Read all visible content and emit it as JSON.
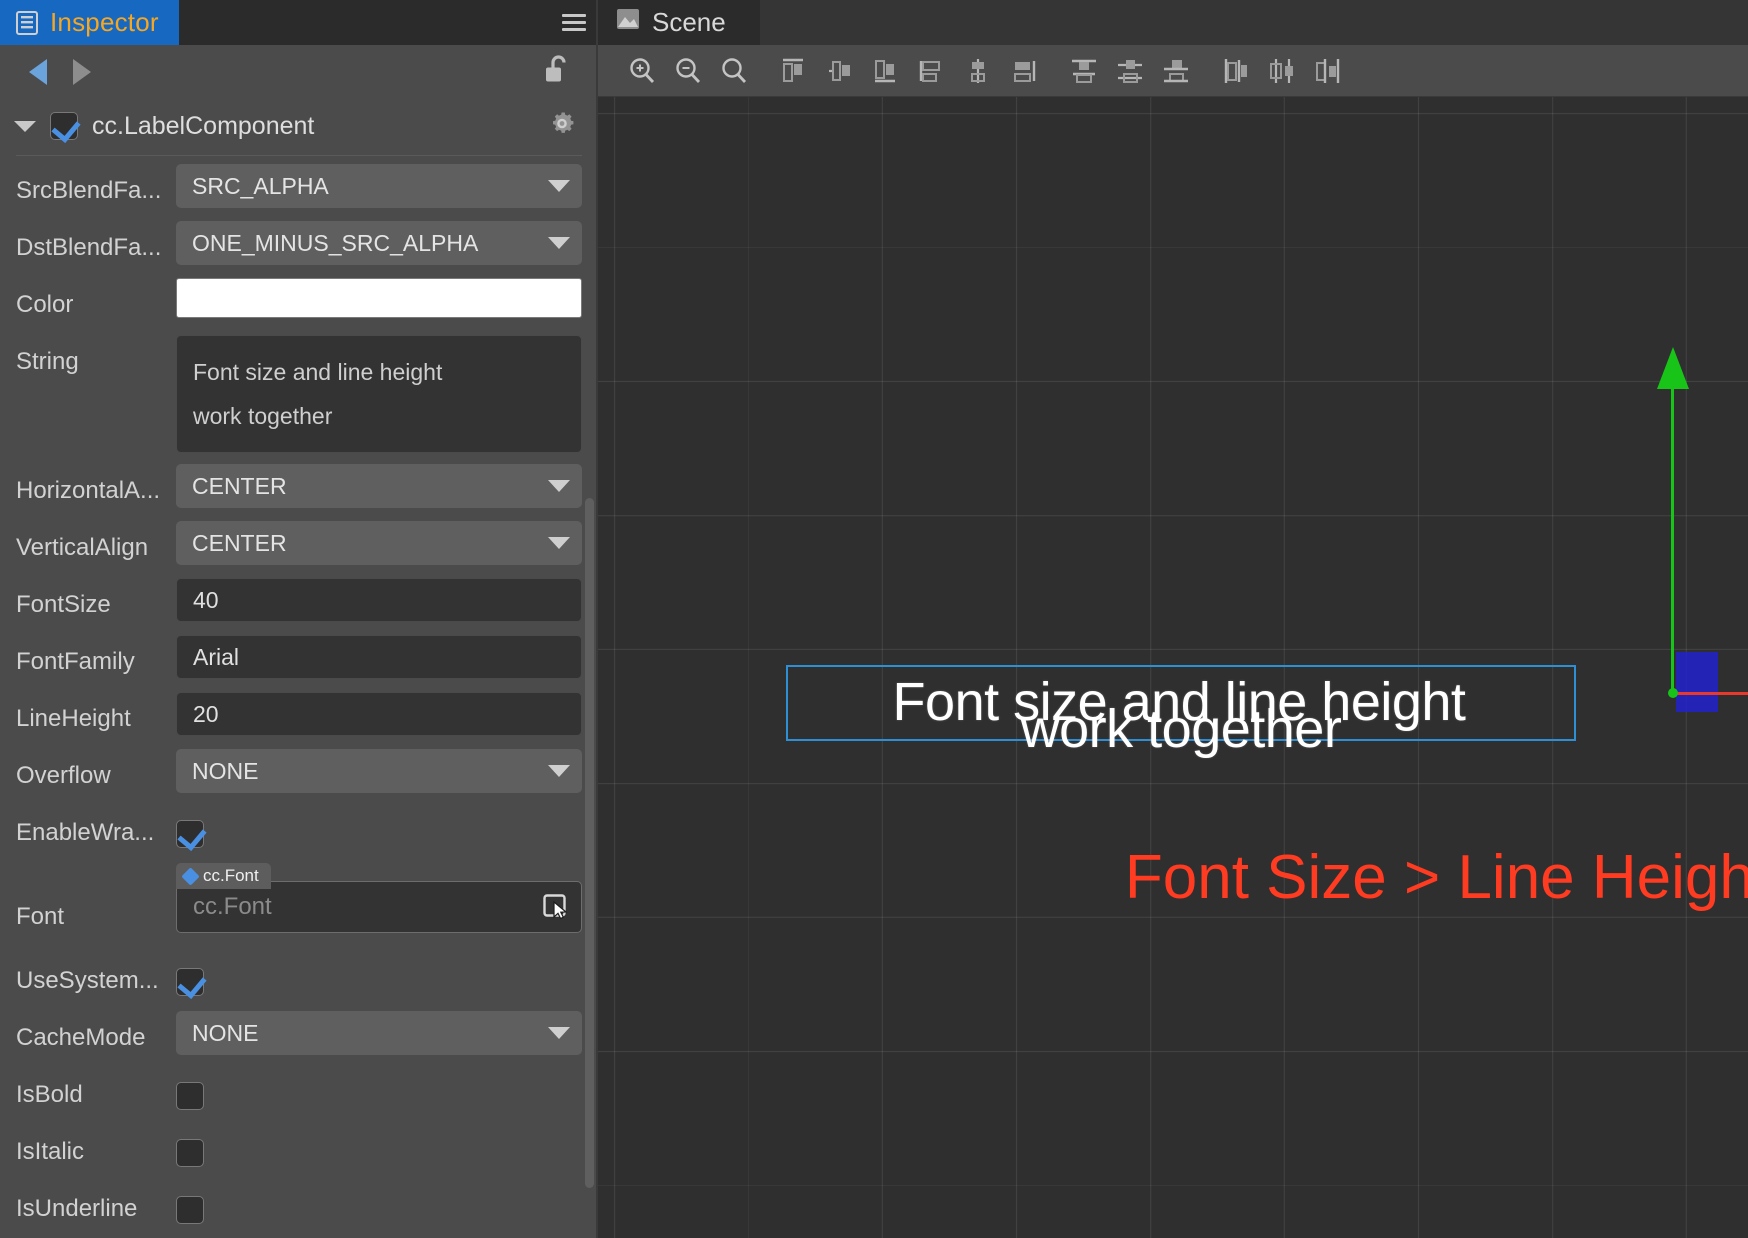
{
  "inspector": {
    "tab_label": "Inspector",
    "tab_icon": "inspector-icon",
    "menu_icon": "hamburger-menu-icon",
    "nav": {
      "back_icon": "arrow-left-icon",
      "forward_icon": "arrow-right-icon",
      "lock_icon": "unlocked-padlock-icon"
    },
    "component": {
      "title": "cc.LabelComponent",
      "enabled": true,
      "collapse_icon": "caret-down-icon",
      "settings_icon": "gear-icon"
    },
    "properties": [
      {
        "label": "SrcBlendFa...",
        "type": "select",
        "value": "SRC_ALPHA",
        "name": "src-blend-factor"
      },
      {
        "label": "DstBlendFa...",
        "type": "select",
        "value": "ONE_MINUS_SRC_ALPHA",
        "name": "dst-blend-factor"
      },
      {
        "label": "Color",
        "type": "color",
        "value": "#FFFFFF",
        "name": "color"
      },
      {
        "label": "String",
        "type": "textarea",
        "lines": [
          "Font size and line height",
          "work together"
        ],
        "name": "string"
      },
      {
        "label": "HorizontalA...",
        "type": "select",
        "value": "CENTER",
        "name": "horizontal-align"
      },
      {
        "label": "VerticalAlign",
        "type": "select",
        "value": "CENTER",
        "name": "vertical-align"
      },
      {
        "label": "FontSize",
        "type": "input",
        "value": "40",
        "name": "font-size"
      },
      {
        "label": "FontFamily",
        "type": "input",
        "value": "Arial",
        "name": "font-family"
      },
      {
        "label": "LineHeight",
        "type": "input",
        "value": "20",
        "name": "line-height"
      },
      {
        "label": "Overflow",
        "type": "select",
        "value": "NONE",
        "name": "overflow"
      },
      {
        "label": "EnableWra...",
        "type": "checkbox",
        "checked": true,
        "name": "enable-wrap-text"
      },
      {
        "label": "Font",
        "type": "asset",
        "tag": "cc.Font",
        "placeholder": "cc.Font",
        "name": "font-asset"
      },
      {
        "label": "UseSystem...",
        "type": "checkbox",
        "checked": true,
        "name": "use-system-font"
      },
      {
        "label": "CacheMode",
        "type": "select",
        "value": "NONE",
        "name": "cache-mode"
      },
      {
        "label": "IsBold",
        "type": "checkbox",
        "checked": false,
        "name": "is-bold"
      },
      {
        "label": "IsItalic",
        "type": "checkbox",
        "checked": false,
        "name": "is-italic"
      },
      {
        "label": "IsUnderline",
        "type": "checkbox",
        "checked": false,
        "name": "is-underline"
      }
    ]
  },
  "scene": {
    "tab_label": "Scene",
    "tab_icon": "scene-image-icon",
    "toolbar": [
      {
        "name": "zoom-in-icon",
        "title": "Zoom In"
      },
      {
        "name": "zoom-out-icon",
        "title": "Zoom Out"
      },
      {
        "name": "zoom-reset-icon",
        "title": "Zoom Reset"
      },
      {
        "name": "align-left-icon",
        "title": "Align Left"
      },
      {
        "name": "align-horizontal-center-icon",
        "title": "Align Horizontal Center"
      },
      {
        "name": "align-right-icon",
        "title": "Align Right"
      },
      {
        "name": "align-top-icon",
        "title": "Align Top"
      },
      {
        "name": "align-vertical-center-icon",
        "title": "Align Vertical Center"
      },
      {
        "name": "align-bottom-icon",
        "title": "Align Bottom"
      },
      {
        "name": "distribute-top-icon",
        "title": "Distribute Top"
      },
      {
        "name": "distribute-vertical-center-icon",
        "title": "Distribute Vertical Center"
      },
      {
        "name": "distribute-bottom-icon",
        "title": "Distribute Bottom"
      },
      {
        "name": "distribute-left-icon",
        "title": "Distribute Left"
      },
      {
        "name": "distribute-horizontal-center-icon",
        "title": "Distribute Horizontal Center"
      },
      {
        "name": "distribute-right-icon",
        "title": "Distribute Right"
      }
    ],
    "selected_node": {
      "text_lines": [
        "Font size and line height",
        "work together"
      ],
      "selection_color": "#2E8FD4",
      "text_color": "#FFFFFF"
    },
    "gizmo": {
      "y_axis_color": "#19C419",
      "x_axis_color": "#E8392C",
      "z_plane_color": "#2222C8"
    },
    "annotation": {
      "text": "Font Size > Line Height",
      "color": "#FF3B21"
    }
  }
}
